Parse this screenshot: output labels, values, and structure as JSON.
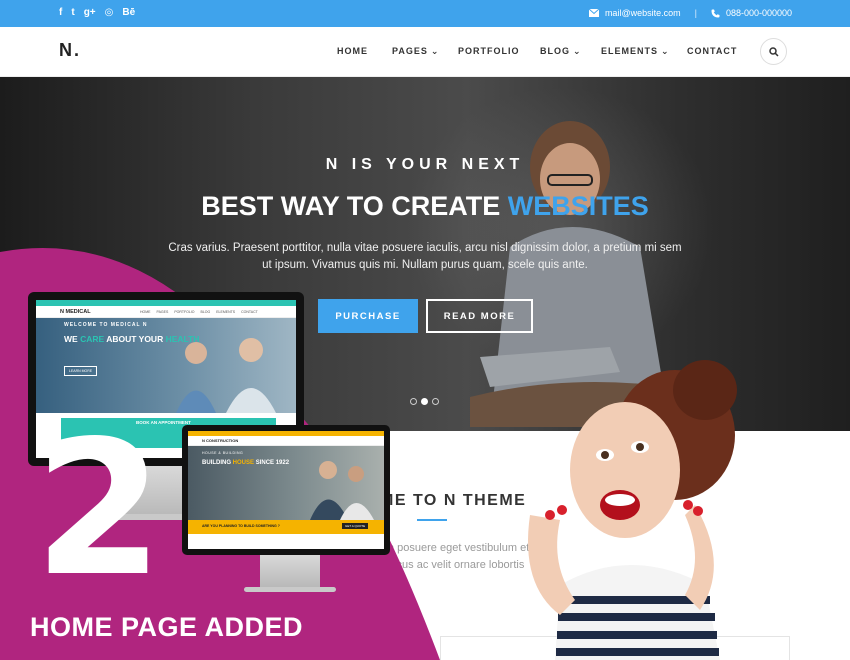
{
  "topbar": {
    "social_icons": [
      "facebook-icon",
      "twitter-icon",
      "google-plus-icon",
      "dribbble-icon",
      "behance-icon"
    ],
    "social_glyphs": [
      "f",
      "t",
      "g+",
      "◎",
      "Bē"
    ],
    "email": "mail@website.com",
    "separator": "|",
    "phone": "088-000-000000"
  },
  "nav": {
    "logo": "N.",
    "items": [
      {
        "label": "HOME",
        "active": true,
        "dropdown": false
      },
      {
        "label": "PAGES",
        "active": false,
        "dropdown": true
      },
      {
        "label": "PORTFOLIO",
        "active": false,
        "dropdown": false
      },
      {
        "label": "BLOG",
        "active": false,
        "dropdown": true
      },
      {
        "label": "ELEMENTS",
        "active": false,
        "dropdown": true
      },
      {
        "label": "CONTACT",
        "active": false,
        "dropdown": false
      }
    ]
  },
  "hero": {
    "kicker": "N IS YOUR NEXT",
    "title_main": "BEST WAY TO CREATE",
    "title_highlight": "WEBSITES",
    "text": "Cras varius. Praesent porttitor, nulla vitae posuere iaculis, arcu nisl dignissim dolor, a pretium mi sem ut ipsum. Vivamus quis mi. Nullam purus quam, scele quis ante.",
    "purchase_label": "PURCHASE",
    "read_more_label": "READ MORE",
    "slide_count": 3,
    "active_slide": 2
  },
  "welcome": {
    "title": "ME TO N THEME",
    "text": "a posuere eget vestibulum et to lacus ac velit ornare lobortis"
  },
  "promo": {
    "number": "2",
    "caption": "HOME PAGE ADDED",
    "color": "#b0257f"
  },
  "monitor_medical": {
    "logo": "N MEDICAL",
    "menu": [
      "HOME",
      "PAGES",
      "PORTFOLIO",
      "BLOG",
      "ELEMENTS",
      "CONTACT"
    ],
    "welcome": "WELCOME TO MEDICAL N",
    "headline_a": "WE",
    "headline_b": "CARE",
    "headline_c": "ABOUT YOUR",
    "headline_d": "HEALTH",
    "button": "LEARN MORE",
    "booking": "BOOK AN APPOINTMENT"
  },
  "monitor_construction": {
    "logo": "N CONSTRUCTION",
    "small": "HOUSE & BUILDING",
    "headline_a": "BUILDING",
    "headline_b": "HOUSE",
    "headline_c": "SINCE 1922",
    "bar_text": "ARE YOU PLANNING TO BUILD SOMETHING ?",
    "bar_button": "GET A QUOTE"
  },
  "colors": {
    "accent": "#3fa3ec",
    "medical": "#2bc3b2",
    "construction": "#f5b300"
  }
}
